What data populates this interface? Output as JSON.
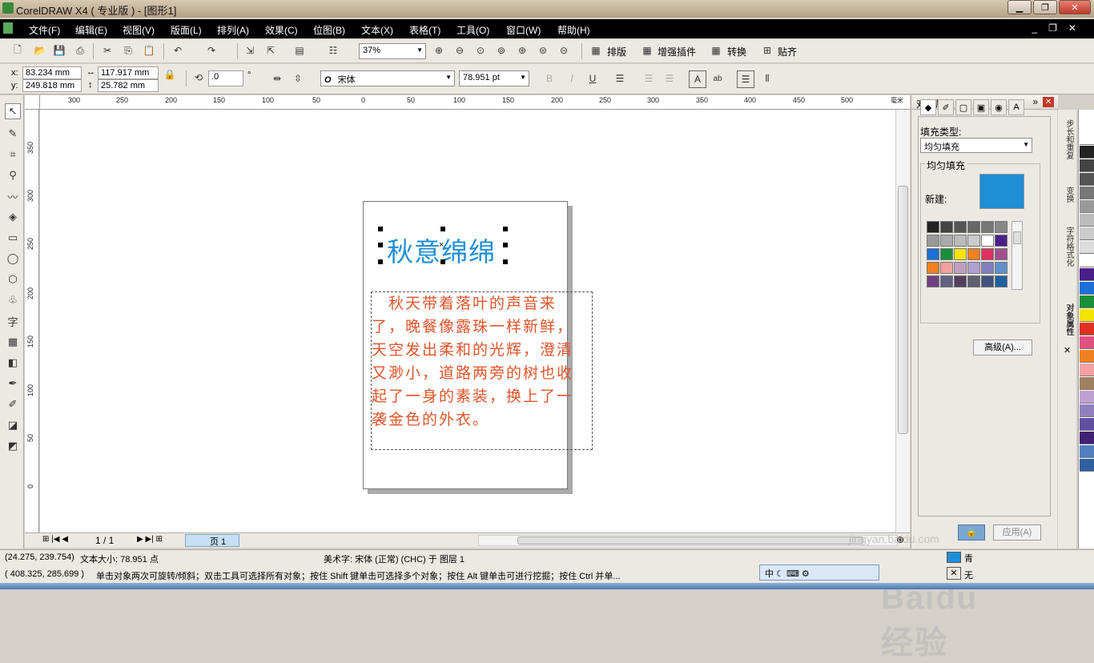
{
  "window": {
    "title": "CorelDRAW X4 ( 专业版 ) - [图形1]"
  },
  "menu": {
    "items": [
      "文件(F)",
      "编辑(E)",
      "视图(V)",
      "版面(L)",
      "排列(A)",
      "效果(C)",
      "位图(B)",
      "文本(X)",
      "表格(T)",
      "工具(O)",
      "窗口(W)",
      "帮助(H)"
    ]
  },
  "toolbar": {
    "zoom": "37%",
    "labels": [
      "排版",
      "增强插件",
      "转换",
      "贴齐"
    ]
  },
  "propbar": {
    "x": "83.234 mm",
    "y": "249.818 mm",
    "w": "117.917 mm",
    "h": "25.782 mm",
    "angle": ".0",
    "font": "宋体",
    "size": "78.951 pt",
    "x_label": "x:",
    "y_label": "y:"
  },
  "rulers": {
    "h": [
      "300",
      "250",
      "200",
      "150",
      "100",
      "50",
      "0",
      "50",
      "100",
      "150",
      "200",
      "250",
      "300",
      "350",
      "400",
      "450",
      "500"
    ],
    "h_unit": "毫米",
    "v": [
      "350",
      "300",
      "250",
      "200",
      "150",
      "100",
      "50",
      "0"
    ]
  },
  "document": {
    "heading": "秋意绵绵",
    "body": "　秋天带着落叶的声音来了，晚餐像露珠一样新鲜，天空发出柔和的光辉，澄清又渺小，道路两旁的树也收起了一身的素装，换上了一袭金色的外衣。"
  },
  "nav": {
    "page_count": "1 / 1",
    "page_tab": "页 1"
  },
  "panel": {
    "title": "对象属性",
    "fill_type_label": "填充类型:",
    "fill_type": "均匀填充",
    "group_label": "均匀填充",
    "new_label": "新建:",
    "advanced": "高级(A)...",
    "apply": "应用(A)"
  },
  "sidetabs": [
    "步长和重复",
    "变换",
    "字符格式化",
    "对象属性"
  ],
  "status": {
    "line1_coords": "(24.275, 239.754)",
    "line1_size": "文本大小: 78.951 点",
    "line1_info": "美术字: 宋体 (正常) (CHC) 于 图层 1",
    "line2_coords": "( 408.325, 285.699 )",
    "line2_hint": "单击对象两次可旋转/倾斜；双击工具可选择所有对象；按住 Shift 键单击可选择多个对象；按住 Alt 键单击可进行挖掘；按住 Ctrl 并单...",
    "fill_label": "青",
    "outline_label": "无"
  },
  "ime": {
    "text": "中"
  },
  "watermark": {
    "main": "Baidu经验",
    "sub": "jingyan.baidu.com"
  },
  "colors": {
    "heading": "#1e8fd6",
    "body": "#e0552b",
    "new_fill": "#1e8fd6"
  }
}
